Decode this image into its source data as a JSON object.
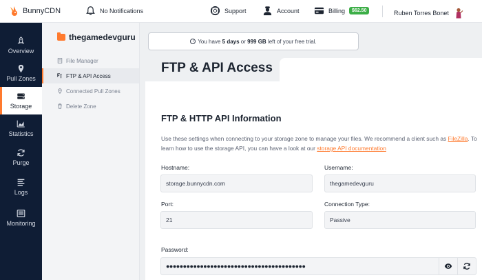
{
  "brand": {
    "name": "BunnyCDN",
    "accent": "#ff7a2e"
  },
  "topbar": {
    "notifications": "No Notifications",
    "support": "Support",
    "account": "Account",
    "billing": "Billing",
    "balance": "$62.50",
    "user": "Ruben Torres Bonet"
  },
  "leftnav": {
    "items": [
      {
        "label": "Overview",
        "icon": "rocket-icon"
      },
      {
        "label": "Pull Zones",
        "icon": "map-pin-icon"
      },
      {
        "label": "Storage",
        "icon": "storage-icon"
      },
      {
        "label": "Statistics",
        "icon": "chart-icon"
      },
      {
        "label": "Purge",
        "icon": "refresh-icon"
      },
      {
        "label": "Logs",
        "icon": "logs-icon"
      },
      {
        "label": "Monitoring",
        "icon": "monitor-icon"
      }
    ]
  },
  "subnav": {
    "zone": "thegamedevguru",
    "items": [
      {
        "label": "File Manager",
        "icon": "file-icon"
      },
      {
        "label": "FTP & API Access",
        "icon": "ftp-icon"
      },
      {
        "label": "Connected Pull Zones",
        "icon": "pin-icon"
      },
      {
        "label": "Delete Zone",
        "icon": "trash-icon"
      }
    ]
  },
  "trial": {
    "prefix": "You have ",
    "days": "5 days",
    "middle": " or ",
    "gb": "999 GB",
    "suffix": " left of your free trial."
  },
  "page": {
    "title": "FTP & API Access",
    "section_title": "FTP & HTTP API Information",
    "desc_1": "Use these settings when connecting to your storage zone to manage your files. We recommend a client such as ",
    "desc_link1": "FileZilla",
    "desc_2": ". To learn how to use the storage API, you can have a look at our ",
    "desc_link2": "storage API documentation",
    "hostname_label": "Hostname:",
    "hostname_value": "storage.bunnycdn.com",
    "username_label": "Username:",
    "username_value": "thegamedevguru",
    "port_label": "Port:",
    "port_value": "21",
    "connection_label": "Connection Type:",
    "connection_value": "Passive",
    "password_label": "Password:",
    "password_value": "●●●●●●●●●●●●●●●●●●●●●●●●●●●●●●●●●●●●●●●●●"
  }
}
